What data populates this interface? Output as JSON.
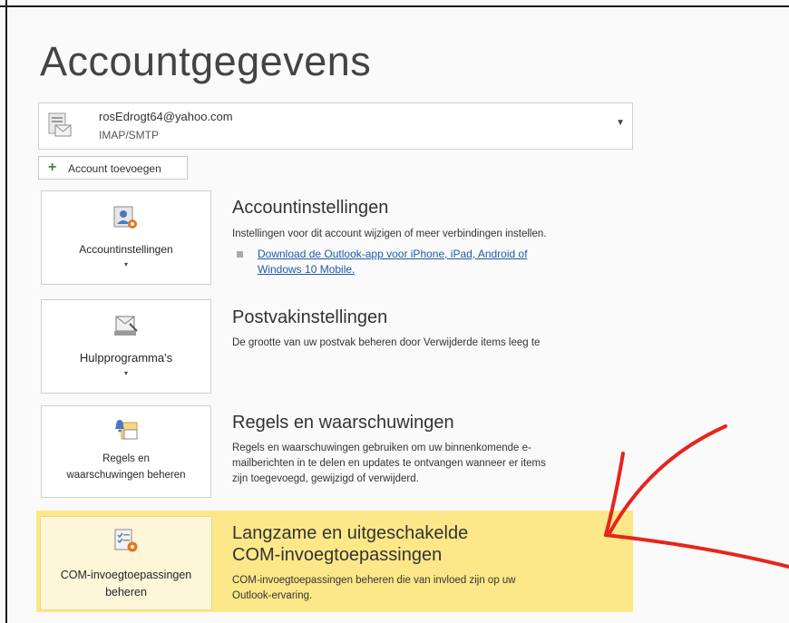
{
  "page": {
    "title": "Accountgegevens"
  },
  "account": {
    "email": "rosEdrogt64@yahoo.com",
    "type": "IMAP/SMTP",
    "icon": "mail-account-icon",
    "caret_icon": "chevron-down-icon"
  },
  "add_account": {
    "label": "Account toevoegen",
    "icon": "plus-icon"
  },
  "sections": [
    {
      "tile_label": "Accountinstellingen",
      "tile_icon": "account-settings-icon",
      "title": "Accountinstellingen",
      "description": "Instellingen voor dit account wijzigen of meer verbindingen instellen.",
      "link_line1": "Download de Outlook-app voor iPhone, iPad, Android of",
      "link_line2": "Windows 10 Mobile."
    },
    {
      "tile_label": "Hulpprogramma's",
      "tile_icon": "mailbox-tools-icon",
      "title": "Postvakinstellingen",
      "description": "De grootte van uw postvak beheren door Verwijderde items leeg te"
    },
    {
      "tile_label_line1": "Regels en",
      "tile_label_line2": "waarschuwingen beheren",
      "tile_icon": "rules-alerts-icon",
      "title": "Regels en waarschuwingen",
      "desc_line1": "Regels en waarschuwingen gebruiken om uw binnenkomende e-",
      "desc_line2": "mailberichten in te delen en updates te ontvangen wanneer er items",
      "desc_line3": "zijn toegevoegd, gewijzigd of verwijderd."
    },
    {
      "tile_label_line1": "COM-invoegtoepassingen",
      "tile_label_line2": "beheren",
      "tile_icon": "com-addins-icon",
      "title_line1": "Langzame en uitgeschakelde",
      "title_line2": "COM-invoegtoepassingen",
      "desc_line1": "COM-invoegtoepassingen beheren die van invloed zijn op uw",
      "desc_line2": "Outlook-ervaring."
    }
  ],
  "colors": {
    "highlight": "#fde889",
    "annotation": "#e8241b",
    "link": "#1f5ba8"
  }
}
